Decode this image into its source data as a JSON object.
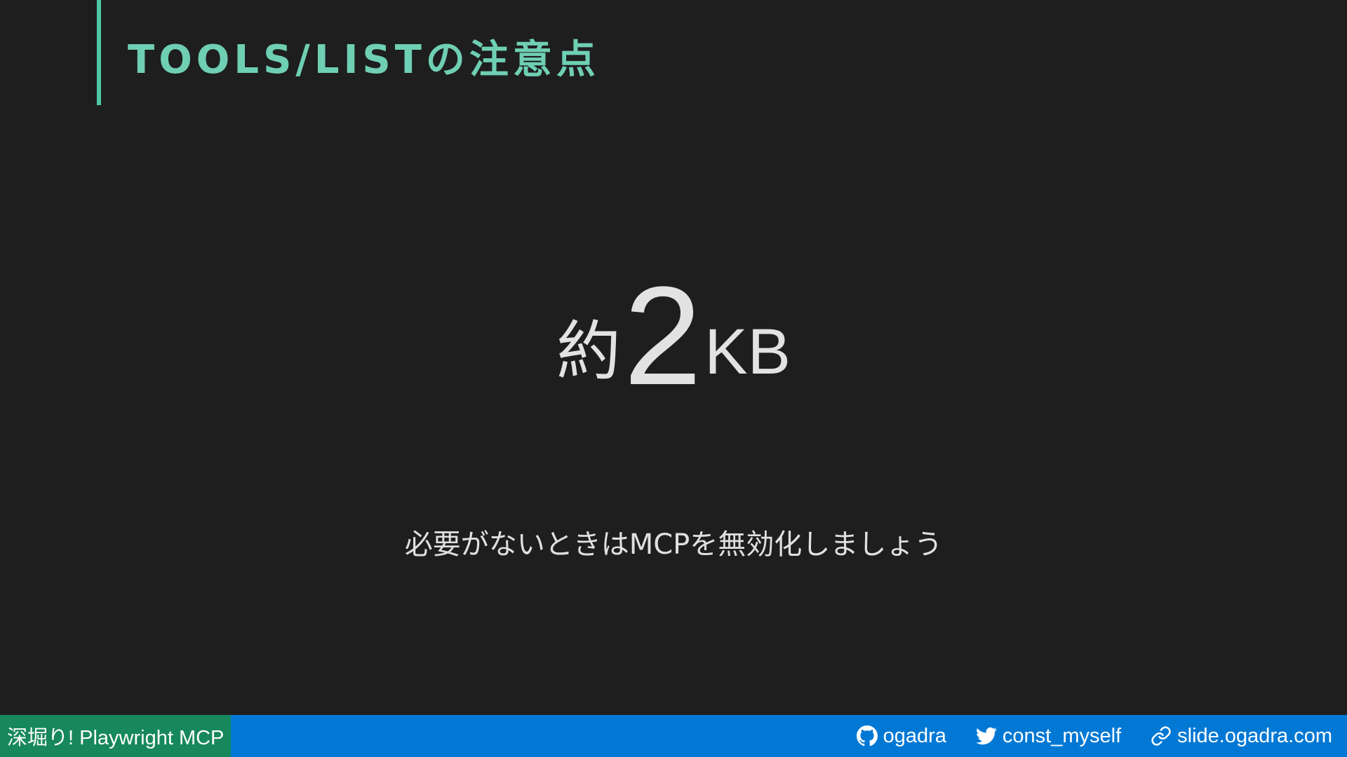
{
  "slide": {
    "title": "TOOLS/LISTの注意点",
    "headline": {
      "prefix": "約",
      "number": "2",
      "unit": "KB"
    },
    "subtext": "必要がないときはMCPを無効化しましょう"
  },
  "footer": {
    "presentation_title": "深堀り! Playwright MCP",
    "links": [
      {
        "icon": "github-icon",
        "label": "ogadra"
      },
      {
        "icon": "twitter-icon",
        "label": "const_myself"
      },
      {
        "icon": "link-icon",
        "label": "slide.ogadra.com"
      }
    ]
  },
  "colors": {
    "background": "#1e1e1e",
    "title_accent": "#4ec9a5",
    "footer_blue": "#0078d4",
    "footer_green": "#16885c"
  }
}
